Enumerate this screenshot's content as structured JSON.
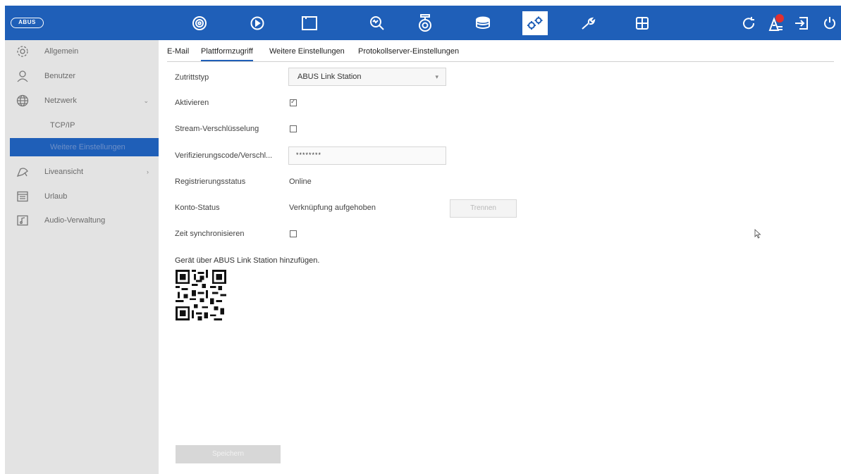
{
  "brand": {
    "logo_text": "ABUS",
    "primary_color": "#1f5fb8"
  },
  "top_toolbar": {
    "icons": [
      "camera-live-icon",
      "playback-icon",
      "folder-icon",
      "search-icon",
      "dome-camera-icon",
      "storage-icon",
      "settings-gears-icon",
      "wrench-icon",
      "grid-icon",
      "refresh-icon",
      "alarm-notification-icon",
      "logout-icon",
      "power-icon"
    ],
    "active_icon": "settings-gears-icon"
  },
  "sidebar": {
    "items": [
      {
        "label": "Allgemein",
        "icon": "gear-icon"
      },
      {
        "label": "Benutzer",
        "icon": "user-icon"
      },
      {
        "label": "Netzwerk",
        "icon": "globe-icon",
        "arrow": "⌄"
      },
      {
        "label": "TCP/IP"
      },
      {
        "label": "Weitere Einstellungen",
        "selected": true
      },
      {
        "label": "Liveansicht",
        "icon": "live-view-icon",
        "arrow": "›"
      },
      {
        "label": "Urlaub",
        "icon": "calendar-icon"
      },
      {
        "label": "Audio-Verwaltung",
        "icon": "audio-file-icon"
      }
    ]
  },
  "tabs": [
    {
      "label": "E-Mail"
    },
    {
      "label": "Plattformzugriff",
      "active": true
    },
    {
      "label": "Weitere Einstellungen"
    },
    {
      "label": "Protokollserver-Einstellungen"
    }
  ],
  "form": {
    "access_type": {
      "label": "Zutrittstyp",
      "value": "ABUS Link Station"
    },
    "enable": {
      "label": "Aktivieren",
      "checked": true
    },
    "stream_encryption": {
      "label": "Stream-Verschlüsselung",
      "checked": false
    },
    "verification_code": {
      "label": "Verifizierungscode/Verschl...",
      "value": "********"
    },
    "registration_status": {
      "label": "Registrierungsstatus",
      "value": "Online"
    },
    "account_status": {
      "label": "Konto-Status",
      "value": "Verknüpfung aufgehoben",
      "button": "Trennen"
    },
    "time_sync": {
      "label": "Zeit synchronisieren",
      "checked": false
    },
    "qr_caption": "Gerät über ABUS Link Station hinzufügen."
  },
  "apply_button": "Speichern"
}
